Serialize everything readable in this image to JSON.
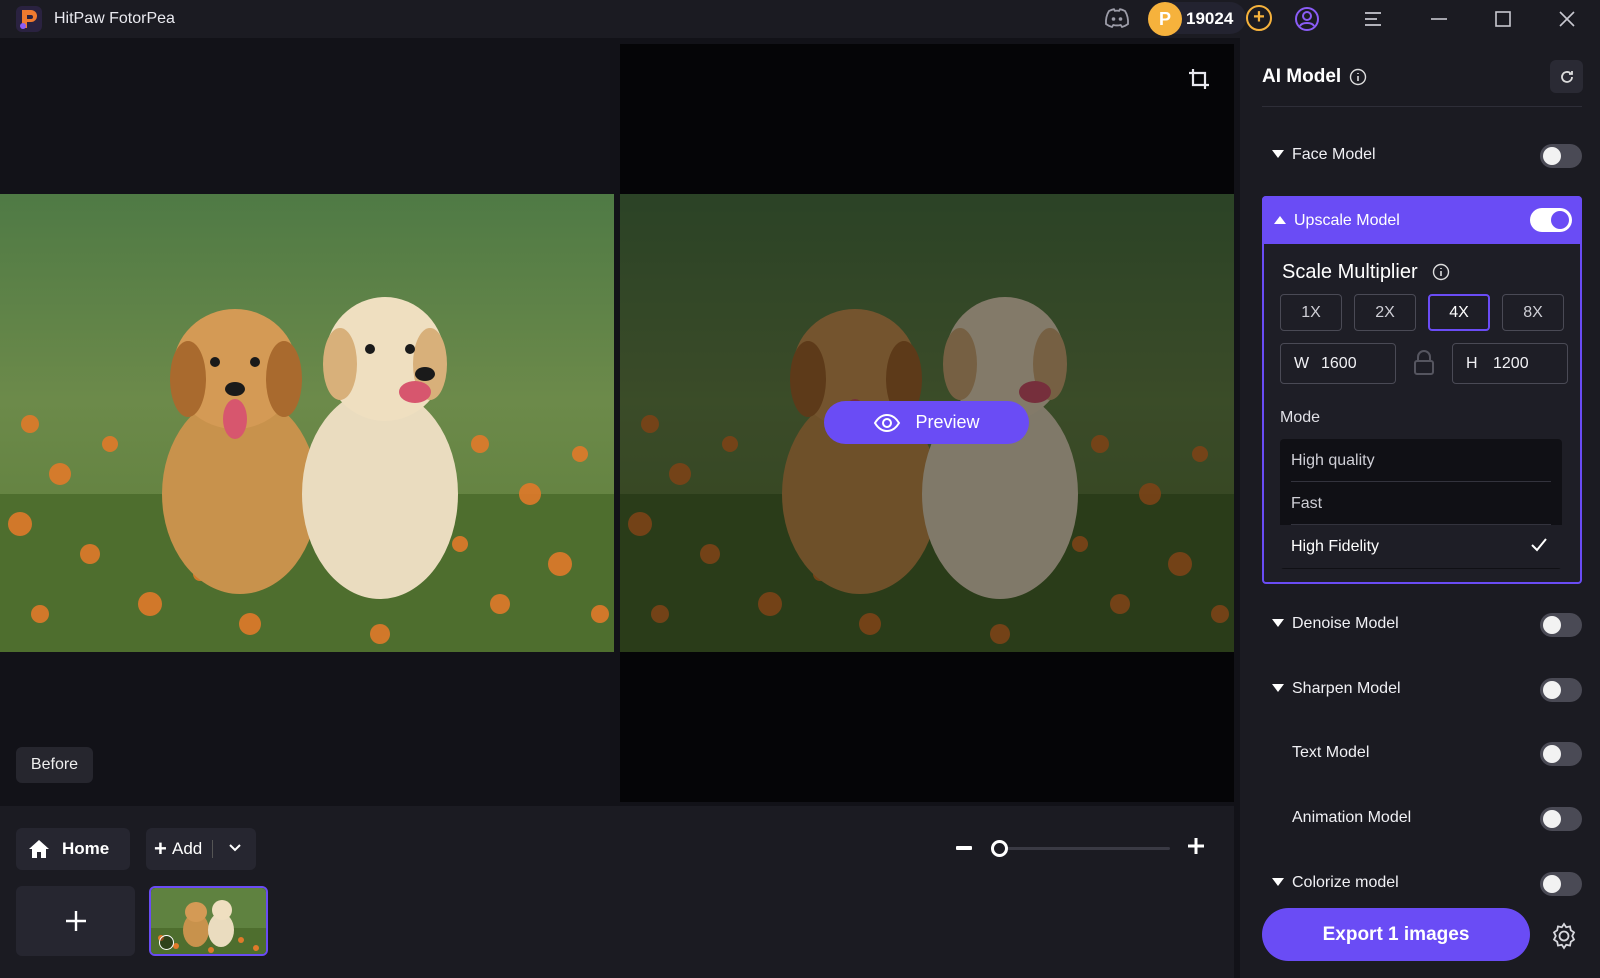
{
  "app": {
    "title": "HitPaw FotorPea",
    "credits": "19024"
  },
  "canvas": {
    "preview_label": "Preview",
    "before_label": "Before"
  },
  "bottom": {
    "home_label": "Home",
    "add_label": "Add"
  },
  "panel": {
    "title": "AI Model",
    "models": {
      "face": "Face Model",
      "upscale": "Upscale Model",
      "denoise": "Denoise Model",
      "sharpen": "Sharpen Model",
      "text": "Text Model",
      "animation": "Animation Model",
      "colorize": "Colorize model"
    },
    "toggles": {
      "face": false,
      "upscale": true,
      "denoise": false,
      "sharpen": false,
      "text": false,
      "animation": false,
      "colorize": false
    },
    "scale_multiplier": {
      "label": "Scale Multiplier",
      "options": [
        "1X",
        "2X",
        "4X",
        "8X"
      ],
      "selected": "4X",
      "width_key": "W",
      "width": "1600",
      "height_key": "H",
      "height": "1200"
    },
    "mode": {
      "label": "Mode",
      "options": [
        "High quality",
        "Fast",
        "High Fidelity"
      ],
      "selected": "High Fidelity"
    },
    "export_label": "Export 1 images"
  },
  "colors": {
    "accent": "#6a4cf5",
    "coin": "#f6b23c",
    "panel_bg": "#1b1b22"
  }
}
